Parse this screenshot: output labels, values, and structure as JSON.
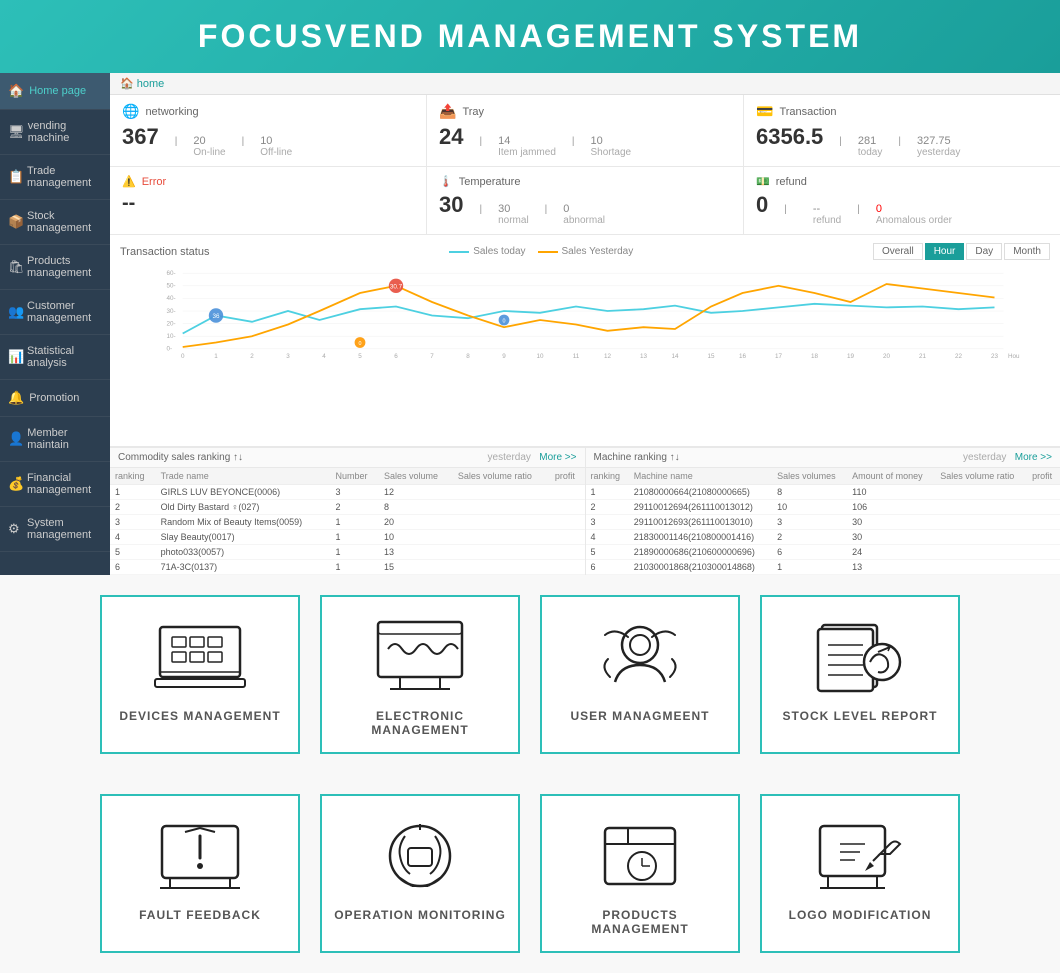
{
  "header": {
    "title": "FOCUSVEND MANAGEMENT SYSTEM"
  },
  "sidebar": {
    "items": [
      {
        "id": "home",
        "label": "Home page",
        "icon": "🏠",
        "active": true
      },
      {
        "id": "vending",
        "label": "vending machine",
        "icon": "🖥"
      },
      {
        "id": "trade",
        "label": "Trade management",
        "icon": "📋"
      },
      {
        "id": "stock",
        "label": "Stock management",
        "icon": "📦"
      },
      {
        "id": "products",
        "label": "Products management",
        "icon": "🛍"
      },
      {
        "id": "customer",
        "label": "Customer management",
        "icon": "👥"
      },
      {
        "id": "statistical",
        "label": "Statistical analysis",
        "icon": "📊"
      },
      {
        "id": "promotion",
        "label": "Promotion",
        "icon": "🔔"
      },
      {
        "id": "member",
        "label": "Member maintain",
        "icon": "👤"
      },
      {
        "id": "financial",
        "label": "Financial management",
        "icon": "💰"
      },
      {
        "id": "system",
        "label": "System management",
        "icon": "⚙"
      }
    ]
  },
  "dashboard": {
    "breadcrumb": "home",
    "stats": {
      "networking": {
        "label": "networking",
        "main": "367",
        "sub1_val": "20",
        "sub1_label": "On-line",
        "sub2_val": "10",
        "sub2_label": "Off-line"
      },
      "tray": {
        "label": "Tray",
        "main": "24",
        "sub1_val": "14",
        "sub1_label": "Item jammed",
        "sub2_val": "10",
        "sub2_label": "Shortage"
      },
      "transaction": {
        "label": "Transaction",
        "main": "6356.5",
        "sub1_val": "281",
        "sub1_label": "today",
        "sub2_val": "327.75",
        "sub2_label": "yesterday"
      }
    },
    "error": {
      "label": "Error",
      "value": "--"
    },
    "temperature": {
      "label": "Temperature",
      "main": "30",
      "sub1_val": "30",
      "sub1_label": "normal",
      "sub2_val": "0",
      "sub2_label": "abnormal"
    },
    "refund": {
      "label": "refund",
      "main": "0",
      "sub1_val": "--",
      "sub1_label": "refund",
      "sub2_val": "0",
      "sub2_label": "Anomalous order"
    },
    "chart": {
      "title": "Transaction status",
      "legend_today": "Sales today",
      "legend_yesterday": "Sales Yesterday",
      "buttons": [
        "Overall",
        "Hour",
        "Day",
        "Month"
      ],
      "active_button": "Hour"
    },
    "commodity_ranking": {
      "title": "Commodity sales ranking",
      "yesterday": "yesterday",
      "more": "More",
      "columns": [
        "ranking",
        "Trade name",
        "Number",
        "Sales volume",
        "Sales volume ratio",
        "profit"
      ],
      "rows": [
        [
          1,
          "GIRLS LUV BEYONCE(0006)",
          3,
          12,
          "",
          ""
        ],
        [
          2,
          "Old Dirty Bastard ♀(027)",
          2,
          8,
          "",
          ""
        ],
        [
          3,
          "Random Mix of Beauty Items(0059)",
          1,
          20,
          "",
          ""
        ],
        [
          4,
          "Slay Beauty(0017)",
          1,
          10,
          "",
          ""
        ],
        [
          5,
          "photo033(0057)",
          1,
          13,
          "",
          ""
        ],
        [
          6,
          "71A-3C(0137)",
          1,
          15,
          "",
          ""
        ]
      ]
    },
    "machine_ranking": {
      "title": "Machine ranking",
      "yesterday": "yesterday",
      "more": "More",
      "columns": [
        "ranking",
        "Machine name",
        "Sales volumes",
        "Amount of money",
        "Sales volume ratio",
        "profit"
      ],
      "rows": [
        [
          1,
          "21080000664(21080000665)",
          8,
          110,
          "",
          ""
        ],
        [
          2,
          "29110012694(261110013012)",
          10,
          106,
          "",
          ""
        ],
        [
          3,
          "29110012693(261110013010)",
          3,
          30,
          "",
          ""
        ],
        [
          4,
          "21830001146(210800001416)",
          2,
          30,
          "",
          ""
        ],
        [
          5,
          "21890000686(210600000696)",
          6,
          24,
          "",
          ""
        ],
        [
          6,
          "21030001868(210300014868)",
          1,
          13,
          "",
          ""
        ]
      ]
    }
  },
  "quick_cards": {
    "row1": [
      {
        "id": "devices",
        "label": "DEVICES MANAGEMENT"
      },
      {
        "id": "electronic",
        "label": "ELECTRONIC MANAGEMENT"
      },
      {
        "id": "user",
        "label": "USER MANAGMEENT"
      },
      {
        "id": "stock",
        "label": "STOCK LEVEL REPORT"
      }
    ],
    "row2": [
      {
        "id": "fault",
        "label": "FAULT FEEDBACK"
      },
      {
        "id": "operation",
        "label": "OPERATION MONITORING"
      },
      {
        "id": "products",
        "label": "PRODUCTS MANAGEMENT"
      },
      {
        "id": "logo",
        "label": "LOGO MODIFICATION"
      }
    ]
  }
}
